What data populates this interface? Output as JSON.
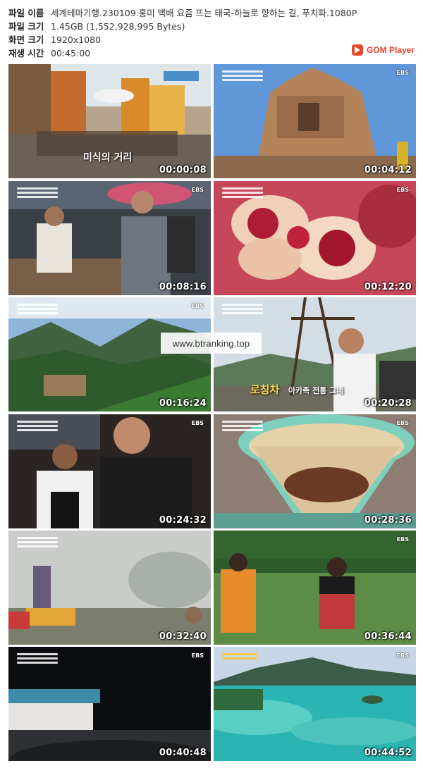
{
  "info": {
    "rows": [
      {
        "label": "파일 이름",
        "value": "세계테마기행.230109.홍미 백배 요즘 뜨는 태국-하늘로 향하는 길, 푸치파.1080P"
      },
      {
        "label": "파일 크기",
        "value": "1.45GB (1,552,928,995 Bytes)"
      },
      {
        "label": "화면 크기",
        "value": "1920x1080"
      },
      {
        "label": "재생 시간",
        "value": "00:45:00"
      }
    ]
  },
  "logo": {
    "text": "GOM Player",
    "icon": "gom-player-icon",
    "color": "#e8462b"
  },
  "watermark": "www.btranking.top",
  "thumbnails": [
    {
      "timestamp": "00:00:08",
      "caption": "미식의 거리",
      "scene": "street"
    },
    {
      "timestamp": "00:04:12",
      "caption": "",
      "scene": "temple",
      "channel": "EBS"
    },
    {
      "timestamp": "00:08:16",
      "caption": "",
      "scene": "market",
      "channel": "EBS"
    },
    {
      "timestamp": "00:12:20",
      "caption": "",
      "scene": "pomegranate",
      "channel": "EBS"
    },
    {
      "timestamp": "00:16:24",
      "caption": "",
      "scene": "mountains",
      "channel": "EBS"
    },
    {
      "timestamp": "00:20:28",
      "caption": "로칭차",
      "caption2": "아카족 전통 그네",
      "scene": "swing"
    },
    {
      "timestamp": "00:24:32",
      "caption": "",
      "scene": "cooking",
      "channel": "EBS"
    },
    {
      "timestamp": "00:28:36",
      "caption": "",
      "scene": "coffee",
      "channel": "EBS"
    },
    {
      "timestamp": "00:32:40",
      "caption": "",
      "scene": "fog"
    },
    {
      "timestamp": "00:36:44",
      "caption": "",
      "scene": "field",
      "channel": "EBS"
    },
    {
      "timestamp": "00:40:48",
      "caption": "",
      "scene": "night",
      "channel": "EBS"
    },
    {
      "timestamp": "00:44:52",
      "caption": "",
      "scene": "island",
      "channel": "EBS"
    }
  ]
}
